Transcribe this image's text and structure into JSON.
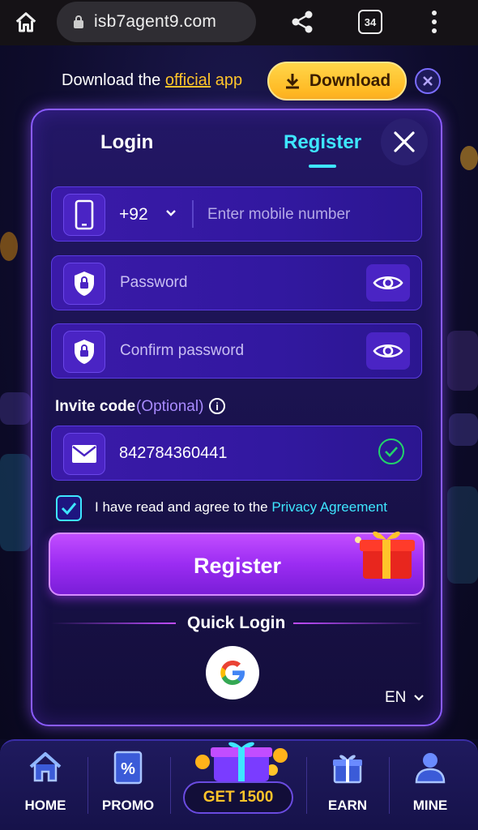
{
  "browser": {
    "url": "isb7agent9.com",
    "tab_count": "34"
  },
  "banner": {
    "text_prefix": "Download the ",
    "text_highlight": "official",
    "text_suffix": " app",
    "download_label": "Download"
  },
  "modal": {
    "tab_login": "Login",
    "tab_register": "Register",
    "phone": {
      "country_code": "+92",
      "placeholder": "Enter mobile number"
    },
    "password_placeholder": "Password",
    "confirm_password_placeholder": "Confirm password",
    "invite": {
      "label": "Invite code",
      "optional": "(Optional)",
      "value": "842784360441"
    },
    "agree": {
      "text": "I have read and agree to the ",
      "link": "Privacy Agreement",
      "checked": true
    },
    "register_button": "Register",
    "quick_login": "Quick Login",
    "language": "EN"
  },
  "bottom_nav": {
    "items": [
      {
        "label": "HOME",
        "icon": "home-icon"
      },
      {
        "label": "PROMO",
        "icon": "promo-icon"
      },
      {
        "label": "GET 1500",
        "icon": "gift-icon"
      },
      {
        "label": "EARN",
        "icon": "earn-gift-icon"
      },
      {
        "label": "MINE",
        "icon": "user-icon"
      }
    ]
  },
  "colors": {
    "accent_cyan": "#3ee6ff",
    "accent_gold": "#ffc42a",
    "accent_purple": "#9b2cf2",
    "success_green": "#22d36a"
  }
}
